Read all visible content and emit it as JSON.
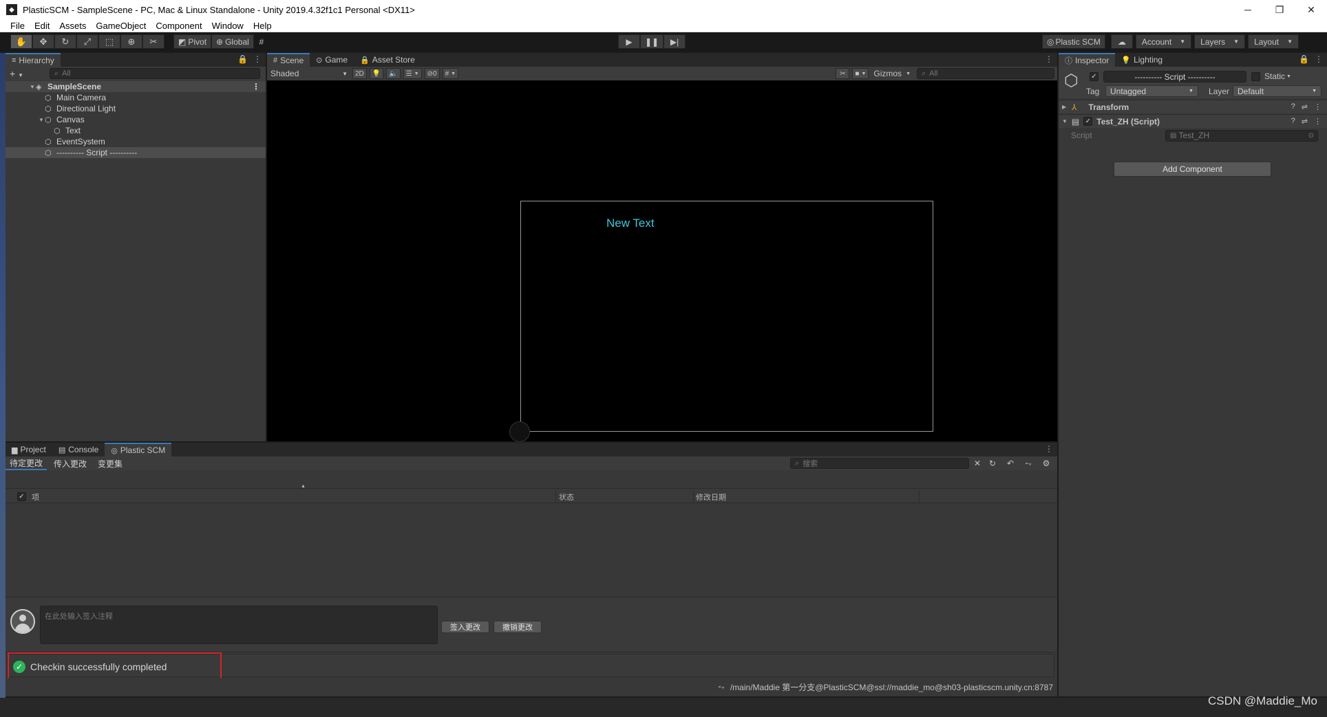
{
  "window": {
    "title": "PlasticSCM - SampleScene - PC, Mac & Linux Standalone - Unity 2019.4.32f1c1 Personal <DX11>",
    "minimize": "─",
    "restore": "❐",
    "close": "✕"
  },
  "menu": [
    "File",
    "Edit",
    "Assets",
    "GameObject",
    "Component",
    "Window",
    "Help"
  ],
  "toolbar": {
    "pivot_label": "Pivot",
    "global_label": "Global",
    "plastic_label": "Plastic SCM",
    "account_label": "Account",
    "layers_label": "Layers",
    "layout_label": "Layout"
  },
  "hierarchy": {
    "tab_label": "Hierarchy",
    "search_placeholder": "All",
    "items": [
      {
        "label": "SampleScene"
      },
      {
        "label": "Main Camera"
      },
      {
        "label": "Directional Light"
      },
      {
        "label": "Canvas"
      },
      {
        "label": "Text"
      },
      {
        "label": "EventSystem"
      },
      {
        "label": "---------- Script ----------"
      }
    ]
  },
  "scene": {
    "tabs": [
      {
        "icon": "#",
        "label": "Scene"
      },
      {
        "icon": "⊙",
        "label": "Game"
      },
      {
        "icon": "🔒",
        "label": "Asset Store"
      }
    ],
    "shading_mode": "Shaded",
    "mode_2d": "2D",
    "hidden_count": "0",
    "gizmos_label": "Gizmos",
    "search_placeholder": "All",
    "canvas_text": "New Text",
    "canvas_text_color": "#3ec7dc"
  },
  "inspector": {
    "tabs": [
      {
        "icon": "ⓘ",
        "label": "Inspector"
      },
      {
        "icon": "💡",
        "label": "Lighting"
      }
    ],
    "object_name": "---------- Script ----------",
    "static_label": "Static",
    "tag_label": "Tag",
    "tag_value": "Untagged",
    "layer_label": "Layer",
    "layer_value": "Default",
    "components": [
      {
        "name": "Transform"
      },
      {
        "name": "Test_ZH (Script)"
      }
    ],
    "script_field_label": "Script",
    "script_field_value": "Test_ZH",
    "add_component_label": "Add Component"
  },
  "bottom": {
    "tabs": [
      {
        "icon": "▆",
        "label": "Project"
      },
      {
        "icon": "▤",
        "label": "Console"
      },
      {
        "icon": "◎",
        "label": "Plastic SCM"
      }
    ],
    "subtabs": [
      "待定更改",
      "传入更改",
      "变更集"
    ],
    "search_placeholder": "搜索",
    "columns": [
      "项",
      "状态",
      "修改日期"
    ],
    "comment_placeholder": "在此处输入签入注释",
    "checkin_button": "签入更改",
    "undo_button": "撤销更改",
    "status_message": "Checkin successfully completed",
    "branch_info": "/main/Maddie  第一分支@PlasticSCM@ssl://maddie_mo@sh03-plasticscm.unity.cn:8787"
  },
  "watermark": "CSDN @Maddie_Mo",
  "colors": {
    "accent": "#3a79bb",
    "success": "#2eb35b",
    "highlight_border": "#d9232b"
  }
}
